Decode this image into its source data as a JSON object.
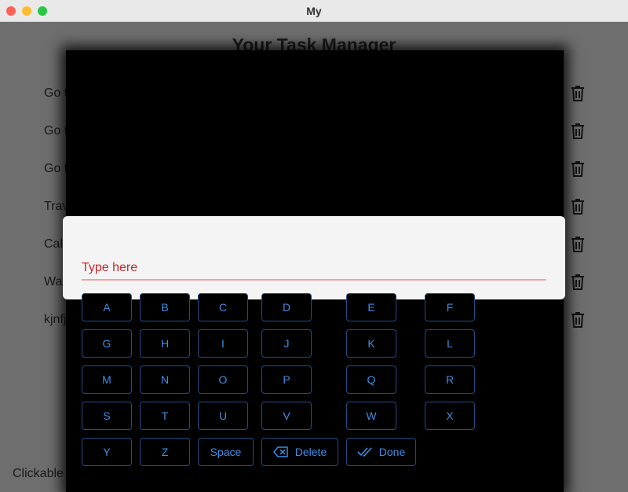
{
  "window": {
    "title": "My"
  },
  "app": {
    "title": "Your Task Manager",
    "tasks": [
      "Go to",
      "Go to",
      "Go to",
      "Trave",
      "Cal",
      "Wat",
      "kjnfj"
    ],
    "footer_text": "Clickable Area for adding task"
  },
  "dialog": {
    "placeholder": "Type here",
    "value": ""
  },
  "keyboard": {
    "rows": [
      [
        "A",
        "B",
        "C",
        "D",
        "E",
        "F"
      ],
      [
        "G",
        "H",
        "I",
        "J",
        "K",
        "L"
      ],
      [
        "M",
        "N",
        "O",
        "P",
        "Q",
        "R"
      ],
      [
        "S",
        "T",
        "U",
        "V",
        "W",
        "X"
      ]
    ],
    "bottom_row": [
      "Y",
      "Z"
    ],
    "space_label": "Space",
    "delete_label": "Delete",
    "done_label": "Done"
  },
  "colors": {
    "key_text": "#3e8ee6",
    "key_border": "#1f4d87",
    "input_text": "#c62828",
    "input_underline": "#e8a5a3"
  },
  "icons": {
    "delete": "backspace-icon",
    "done": "double-check-icon",
    "task_remove": "trash-icon"
  }
}
